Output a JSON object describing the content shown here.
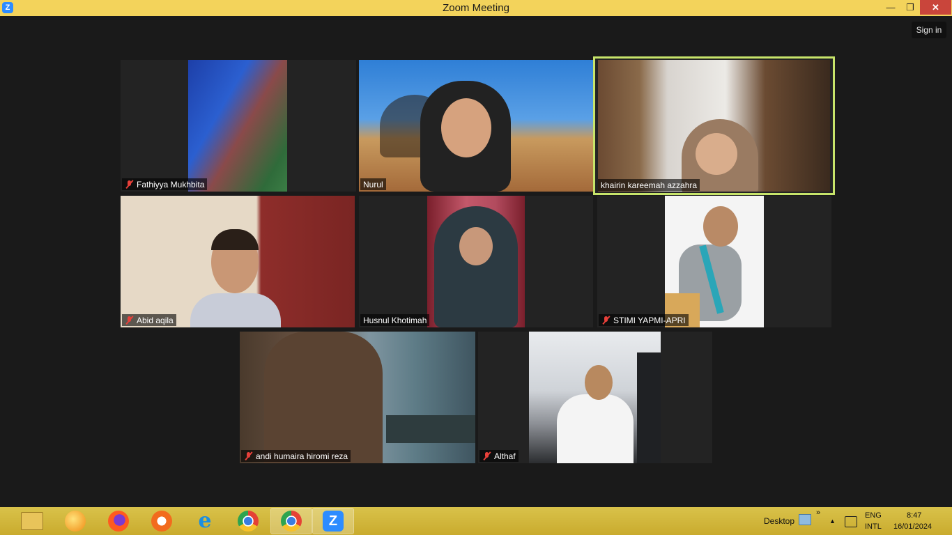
{
  "window": {
    "title": "Zoom Meeting",
    "app_icon_letter": "Z",
    "controls": {
      "minimize": "—",
      "maximize": "❐",
      "close": "✕"
    }
  },
  "header": {
    "sign_in": "Sign in"
  },
  "participants": [
    {
      "name": "Fathiyya Mukhbita",
      "muted": true,
      "active": false
    },
    {
      "name": "Nurul",
      "muted": false,
      "active": false
    },
    {
      "name": "khairin kareemah azzahra",
      "muted": false,
      "active": true
    },
    {
      "name": "Abid aqila",
      "muted": true,
      "active": false
    },
    {
      "name": "Husnul Khotimah",
      "muted": false,
      "active": false
    },
    {
      "name": "STIMI YAPMI-APRI",
      "muted": true,
      "active": false
    },
    {
      "name": "andi humaira hiromi reza",
      "muted": true,
      "active": false
    },
    {
      "name": "Althaf",
      "muted": true,
      "active": false
    }
  ],
  "taskbar": {
    "apps": [
      {
        "name": "file-explorer-icon"
      },
      {
        "name": "orange-app-icon"
      },
      {
        "name": "firefox-icon"
      },
      {
        "name": "brave-icon"
      },
      {
        "name": "internet-explorer-icon"
      },
      {
        "name": "chrome-icon"
      },
      {
        "name": "chrome-user-icon",
        "active": true
      },
      {
        "name": "zoom-icon",
        "active": true
      }
    ],
    "desktop_label": "Desktop",
    "chevrons": "»",
    "tray_up": "▲",
    "language_top": "ENG",
    "language_bottom": "INTL",
    "time": "8:47",
    "date": "16/01/2024"
  },
  "colors": {
    "titlebar": "#f3d35b",
    "active_speaker_border": "#c7e46a",
    "close_button": "#c9453b",
    "muted_icon": "#e8403a"
  }
}
